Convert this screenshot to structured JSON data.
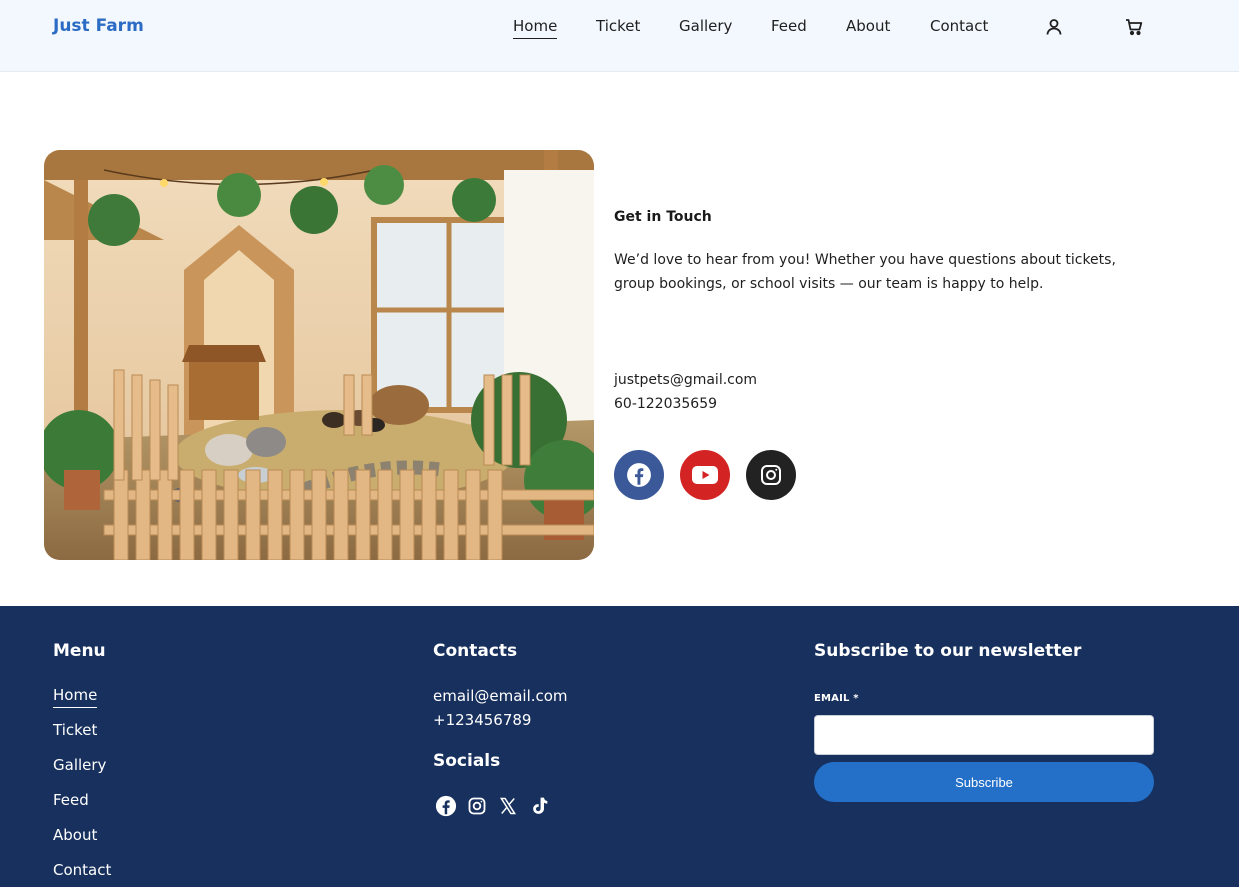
{
  "header": {
    "brand": "Just Farm",
    "nav": [
      "Home",
      "Ticket",
      "Gallery",
      "Feed",
      "About",
      "Contact"
    ],
    "active": "Home",
    "icons": [
      "user-icon",
      "cart-icon"
    ]
  },
  "contact": {
    "title": "Get in Touch",
    "text": "We’d love to hear from you! Whether you have questions about tickets, group bookings, or school visits — our team is happy to help.",
    "email": "justpets@gmail.com",
    "phone": "60-122035659",
    "socials": [
      "facebook-icon",
      "youtube-icon",
      "instagram-icon"
    ],
    "social_colors": [
      "#3b5998",
      "#d42323",
      "#222222"
    ]
  },
  "footer": {
    "menu_title": "Menu",
    "menu": [
      "Home",
      "Ticket",
      "Gallery",
      "Feed",
      "About",
      "Contact"
    ],
    "contacts_title": "Contacts",
    "email": "email@email.com",
    "phone": "+123456789",
    "socials_title": "Socials",
    "socials": [
      "facebook-icon",
      "instagram-icon",
      "x-icon",
      "tiktok-icon"
    ],
    "newsletter_title": "Subscribe to our newsletter",
    "email_label": "EMAIL *",
    "email_value": "",
    "subscribe": "Subscribe"
  },
  "colors": {
    "brand": "#2b6cc4",
    "header_bg": "#f3f8fe",
    "footer_bg": "#17305d",
    "button": "#2470c9"
  }
}
